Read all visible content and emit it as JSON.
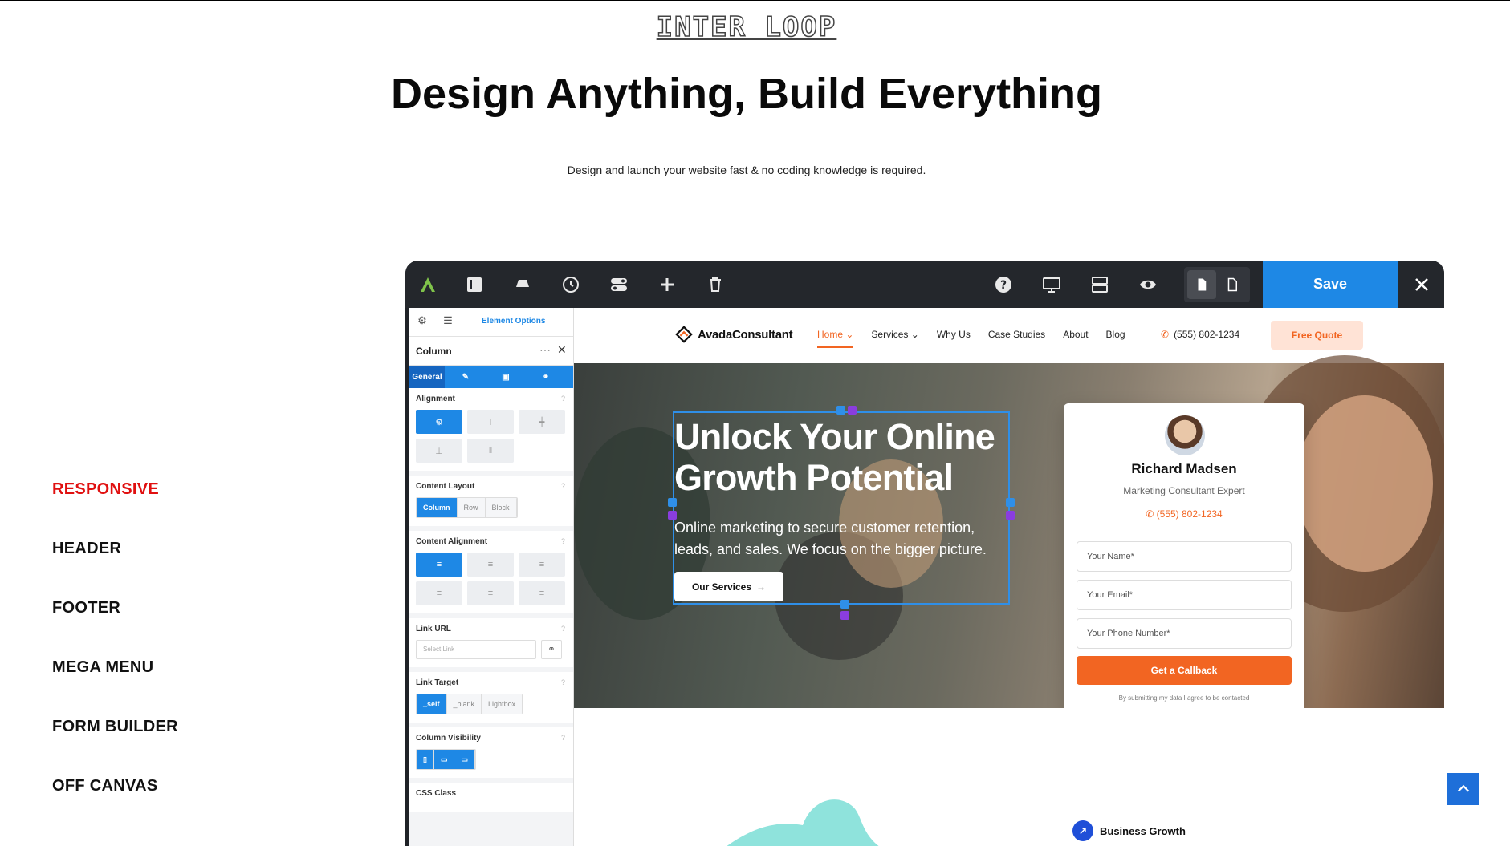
{
  "page": {
    "logo": "INTER LOOP",
    "title": "Design Anything, Build Everything",
    "subtitle": "Design and launch your website fast & no coding knowledge is required."
  },
  "side_nav": {
    "items": [
      {
        "label": "RESPONSIVE",
        "active": true
      },
      {
        "label": "HEADER",
        "active": false
      },
      {
        "label": "FOOTER",
        "active": false
      },
      {
        "label": "MEGA MENU",
        "active": false
      },
      {
        "label": "FORM BUILDER",
        "active": false
      },
      {
        "label": "OFF CANVAS",
        "active": false
      }
    ]
  },
  "builder": {
    "save_label": "Save",
    "toolbar_icons": [
      "avada-logo-icon",
      "sidebar-toggle-icon",
      "eraser-icon",
      "history-icon",
      "toggle-icon",
      "add-icon",
      "trash-icon",
      "help-icon",
      "desktop-icon",
      "layout-icon",
      "preview-icon",
      "page-icon",
      "page-outline-icon",
      "close-icon"
    ],
    "panel": {
      "tab_label": "Element Options",
      "element_title": "Column",
      "subtabs": [
        "General",
        "brush-icon",
        "layers-icon",
        "link-icon"
      ],
      "alignment_label": "Alignment",
      "content_layout_label": "Content Layout",
      "content_layout_options": [
        "Column",
        "Row",
        "Block"
      ],
      "content_alignment_label": "Content Alignment",
      "link_url_label": "Link URL",
      "link_url_placeholder": "Select Link",
      "link_target_label": "Link Target",
      "link_target_options": [
        "_self",
        "_blank",
        "Lightbox"
      ],
      "column_visibility_label": "Column Visibility",
      "css_class_label": "CSS Class"
    }
  },
  "site": {
    "brand": "AvadaConsultant",
    "menu": [
      "Home",
      "Services",
      "Why Us",
      "Case Studies",
      "About",
      "Blog"
    ],
    "phone": "(555) 802-1234",
    "quote_button": "Free Quote",
    "hero_heading": "Unlock Your Online Growth Potential",
    "hero_text": "Online marketing to secure customer retention, leads, and sales. We focus on the bigger picture.",
    "hero_button": "Our Services",
    "card": {
      "name": "Richard Madsen",
      "role": "Marketing Consultant Expert",
      "phone": "(555) 802-1234",
      "name_placeholder": "Your Name*",
      "email_placeholder": "Your Email*",
      "phone_placeholder": "Your Phone Number*",
      "submit": "Get a Callback",
      "note": "By submitting my data I agree to be contacted"
    },
    "badge": "Business Growth"
  },
  "colors": {
    "accent_blue": "#1e88e5",
    "accent_orange": "#f26522",
    "active_red": "#e01010",
    "toolbar_dark": "#24272c"
  }
}
